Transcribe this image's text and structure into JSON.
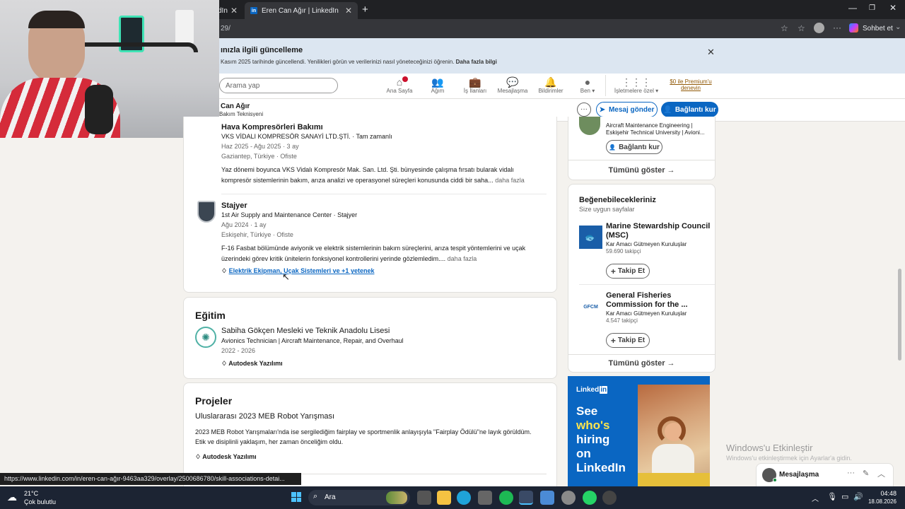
{
  "browser": {
    "tab_prev_title": "dIn",
    "tab_active_title": "Eren Can Ağır | LinkedIn",
    "url_fragment": "29/",
    "copilot_label": "Sohbet et",
    "status_url": "https://www.linkedin.com/in/eren-can-ağır-9463aa329/overlay/2500686780/skill-associations-detai..."
  },
  "banner": {
    "title": "ınızla ilgili güncelleme",
    "text": "Kasım 2025 tarihinde güncellendi. Yenilikleri görün ve verilerinizi nasıl yöneteceğinizi öğrenin.",
    "link": "Daha fazla bilgi"
  },
  "nav": {
    "search_placeholder": "Arama yap",
    "items": [
      "Ana Sayfa",
      "Ağım",
      "İş İlanları",
      "Mesajlaşma",
      "Bildirimler",
      "Ben",
      "İşletmelere özel"
    ],
    "premium": "$0 ile Premium'u denevin"
  },
  "profile": {
    "name": "Can Ağır",
    "headline": "Bakım Teknisyeni",
    "message_btn": "Mesaj gönder",
    "connect_btn": "Bağlantı kur"
  },
  "experience": [
    {
      "title": "Hava Kompresörleri Bakımı",
      "company": "VKS VİDALI KOMPRESÖR SANAYİ LTD.ŞTİ. · Tam zamanlı",
      "dates": "Haz 2025 - Ağu 2025 · 3 ay",
      "location": "Gaziantep, Türkiye · Ofiste",
      "desc1": "Yaz dönemi boyunca VKS Vidalı Kompresör Mak. San. Ltd. Şti. bünyesinde çalışma fırsatı bularak vidalı",
      "desc2": "kompresör sistemlerinin bakım, arıza analizi ve operasyonel süreçleri konusunda ciddi bir saha...",
      "more": "daha fazla"
    },
    {
      "title": "Stajyer",
      "company": "1st Air Supply and Maintenance Center · Stajyer",
      "dates": "Ağu 2024 · 1 ay",
      "location": "Eskişehir, Türkiye · Ofiste",
      "desc1": "F-16 Fasbat bölümünde aviyonik ve elektrik sistemlerinin bakım süreçlerini, arıza tespit yöntemlerini ve uçak",
      "desc2": "üzerindeki görev kritik ünitelerin fonksiyonel kontrollerini yerinde gözlemledim....",
      "more": "daha fazla",
      "skills": "Elektrik Ekipman, Uçak Sistemleri ve +1 yetenek"
    }
  ],
  "education": {
    "heading": "Eğitim",
    "school": "Sabiha Gökçen Mesleki ve Teknik Anadolu Lisesi",
    "degree": "Avionics Technician | Aircraft Maintenance, Repair, and Overhaul",
    "dates": "2022 - 2026",
    "skill": "Autodesk Yazılımı"
  },
  "projects": {
    "heading": "Projeler",
    "title": "Uluslararası 2023 MEB Robot Yarışması",
    "desc1": "2023 MEB Robot Yarışmaları'nda ise sergilediğim fairplay ve sportmenlik anlayışıyla \"Fairplay Ödülü\"ne layık görüldüm.",
    "desc2": "Etik ve disiplinli yaklaşım, her zaman önceliğim oldu.",
    "skill": "Autodesk Yazılımı"
  },
  "sidebar": {
    "person_line1": "Aircraft Maintenance Engineering |",
    "person_line2": "Eskişehir Technical University | Avioni...",
    "connect_btn": "Bağlantı kur",
    "show_all": "Tümünü göster →",
    "pages_heading": "Beğenebilecekleriniz",
    "pages_sub": "Size uygun sayfalar",
    "pages": [
      {
        "name1": "Marine Stewardship Council",
        "name2": "(MSC)",
        "type": "Kar Amacı Gütmeyen Kuruluşlar",
        "followers": "59.690 takipçi",
        "btn": "Takip Et",
        "logo": "MSC"
      },
      {
        "name1": "General Fisheries",
        "name2": "Commission for the ...",
        "type": "Kar Amacı Gütmeyen Kuruluşlar",
        "followers": "4.547 takipçi",
        "btn": "Takip Et",
        "logo": "GFCM"
      }
    ],
    "show_all2": "Tümünü göster →",
    "ad_brand": "Linked",
    "ad_brand_in": "in",
    "ad_line1": "See",
    "ad_line2": "who's",
    "ad_line3": "hiring",
    "ad_line4": "on",
    "ad_line5": "LinkedIn"
  },
  "messaging": {
    "label": "Mesajlaşma"
  },
  "watermark": {
    "line1": "Windows'u Etkinleştir",
    "line2": "Windows'u etkinleştirmek için Ayarlar'a gidin."
  },
  "taskbar": {
    "temp": "21°C",
    "weather": "Çok bulutlu",
    "search": "Ara",
    "time": "04:48",
    "date": "18.08.2026"
  }
}
